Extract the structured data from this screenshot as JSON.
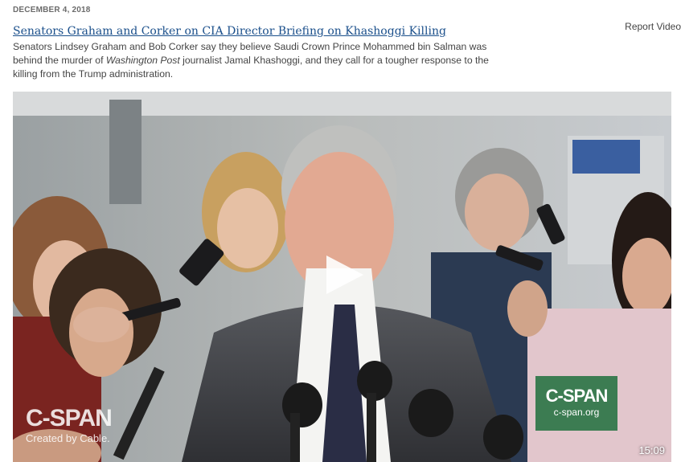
{
  "article": {
    "date": "DECEMBER 4, 2018",
    "title": "Senators Graham and Corker on CIA Director Briefing on Khashoggi Killing",
    "report_label": "Report Video",
    "description_part1": "Senators Lindsey Graham and Bob Corker say they believe Saudi Crown Prince Mohammed bin Salman was behind the murder of ",
    "description_em": "Washington Post",
    "description_part2": " journalist Jamal Khashoggi, and they call for a tougher response to the killing from the Trump administration."
  },
  "video": {
    "watermark_left_logo": "C-SPAN",
    "watermark_left_sub": "Created by Cable.",
    "watermark_right_logo": "C-SPAN",
    "watermark_right_url": "c-span.org",
    "duration": "15:09",
    "play_icon": "play-icon",
    "colors": {
      "link": "#1a4f8b",
      "cspan_green": "#1e6e3c"
    }
  }
}
